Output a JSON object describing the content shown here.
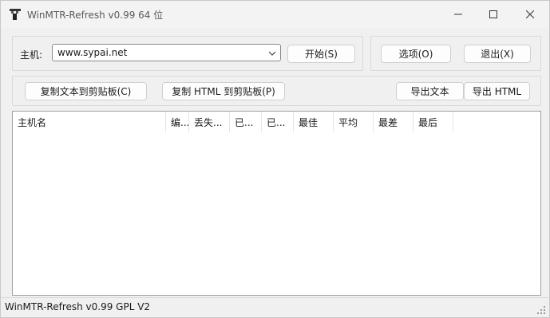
{
  "window": {
    "title": "WinMTR-Refresh v0.99 64 位"
  },
  "host_panel": {
    "host_label": "主机:",
    "host_value": "www.sypai.net",
    "start_button": "开始(S)"
  },
  "options_panel": {
    "options_button": "选项(O)",
    "exit_button": "退出(X)"
  },
  "export_panel": {
    "copy_text_button": "复制文本到剪贴板(C)",
    "copy_html_button": "复制 HTML 到剪贴板(P)",
    "export_text_button": "导出文本",
    "export_html_button": "导出 HTML"
  },
  "list": {
    "columns": [
      "主机名",
      "编...",
      "丢失...",
      "已...",
      "已...",
      "最佳",
      "平均",
      "最差",
      "最后"
    ]
  },
  "status": {
    "text": "WinMTR-Refresh v0.99 GPL V2"
  },
  "colors": {
    "window_bg": "#f0f0f0",
    "button_bg": "#fdfdfd",
    "border": "#cfcfcf"
  }
}
